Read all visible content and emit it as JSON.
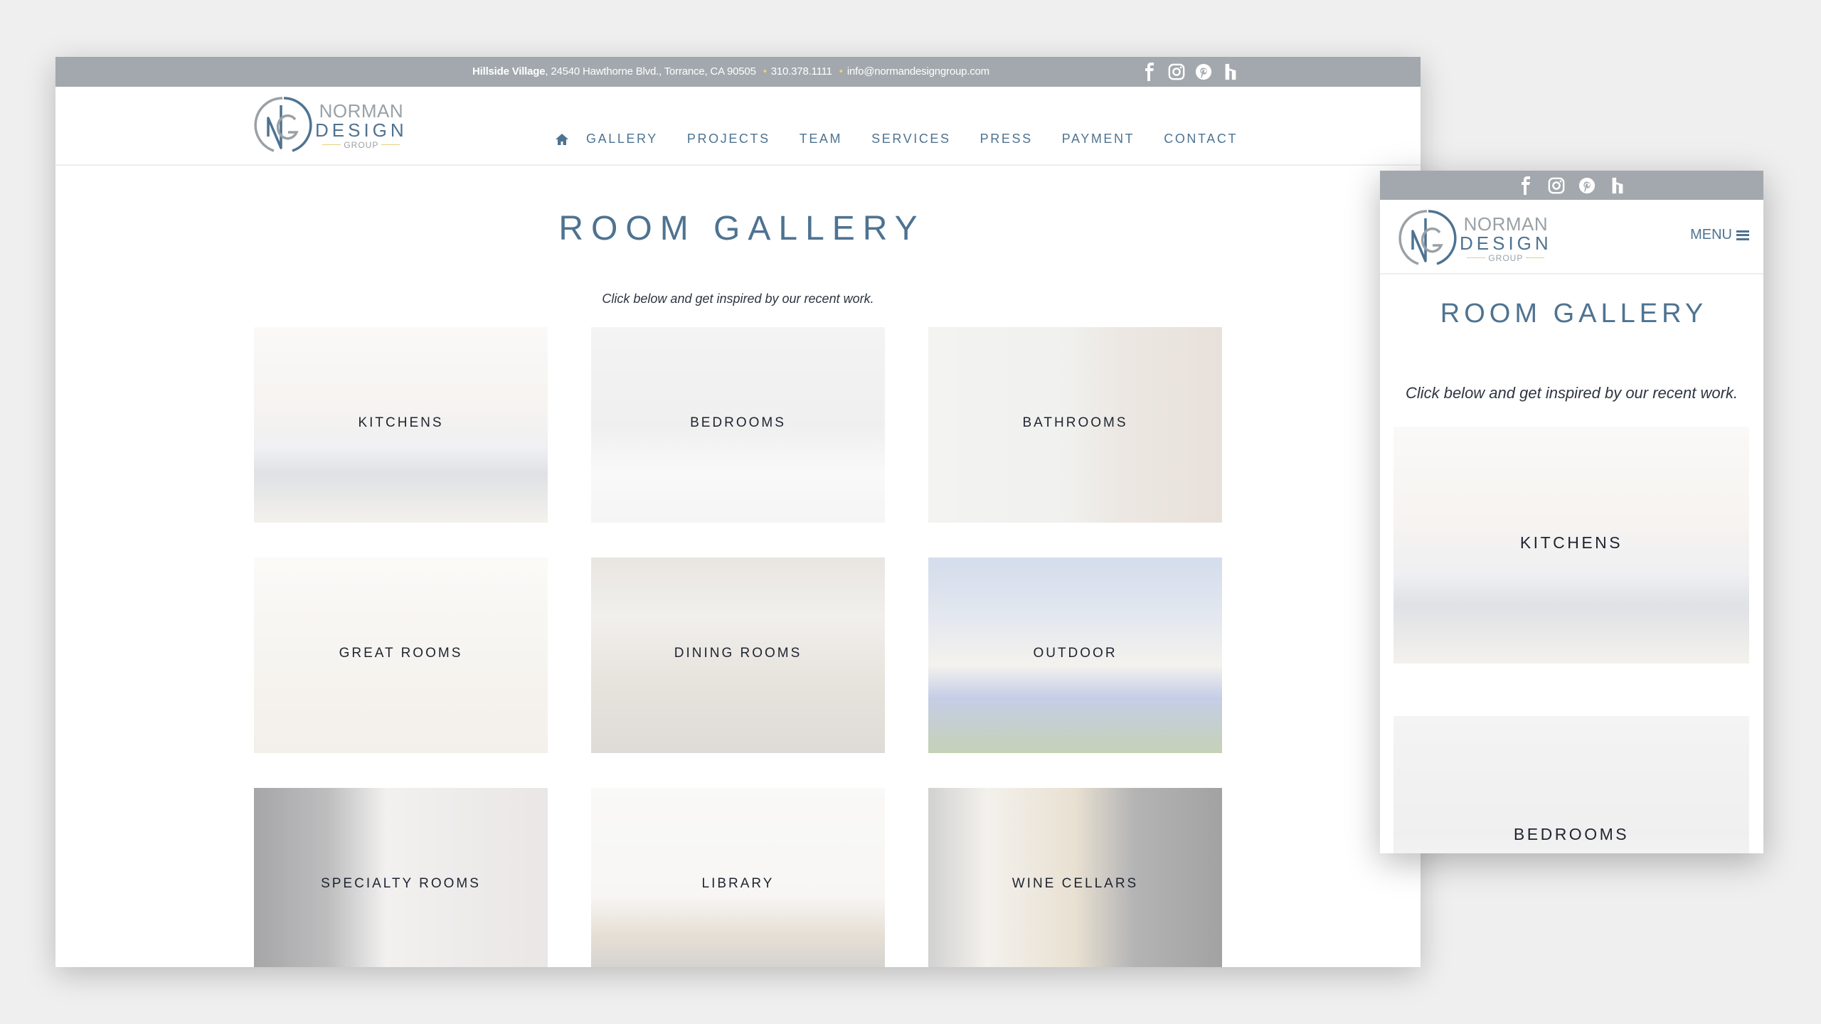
{
  "topbar": {
    "location_bold": "Hillside Village",
    "address": ", 24540 Hawthorne Blvd., Torrance, CA 90505",
    "phone": "310.378.1111",
    "email": "info@normandesigngroup.com",
    "separator": "•",
    "social": [
      {
        "name": "facebook-icon",
        "label": "Facebook"
      },
      {
        "name": "instagram-icon",
        "label": "Instagram"
      },
      {
        "name": "pinterest-icon",
        "label": "Pinterest"
      },
      {
        "name": "houzz-icon",
        "label": "Houzz"
      }
    ]
  },
  "brand": {
    "line1": "NORMAN",
    "line2": "DESIGN",
    "line3": "GROUP",
    "colors": {
      "primary": "#4e7391",
      "secondary": "#9aa1a6",
      "accent": "#e5cf7e",
      "topbar": "#a2a8ad"
    }
  },
  "nav": {
    "home_icon": "home-icon",
    "items": [
      "GALLERY",
      "PROJECTS",
      "TEAM",
      "SERVICES",
      "PRESS",
      "PAYMENT",
      "CONTACT"
    ]
  },
  "page": {
    "title": "ROOM GALLERY",
    "subtitle": "Click below and get inspired by our recent work."
  },
  "gallery": [
    {
      "label": "KITCHENS"
    },
    {
      "label": "BEDROOMS"
    },
    {
      "label": "BATHROOMS"
    },
    {
      "label": "GREAT ROOMS"
    },
    {
      "label": "DINING ROOMS"
    },
    {
      "label": "OUTDOOR"
    },
    {
      "label": "SPECIALTY ROOMS"
    },
    {
      "label": "LIBRARY"
    },
    {
      "label": "WINE CELLARS"
    }
  ],
  "mobile": {
    "menu_label": "MENU",
    "menu_icon": "hamburger-icon",
    "visible_tiles": [
      "KITCHENS",
      "BEDROOMS"
    ]
  }
}
